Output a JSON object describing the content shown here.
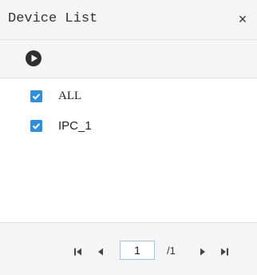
{
  "panel": {
    "title": "Device List",
    "close_symbol": "×"
  },
  "toolbar": {
    "play_icon": "play-circle-icon"
  },
  "devices": [
    {
      "label": "ALL",
      "checked": true
    },
    {
      "label": "IPC_1",
      "checked": true
    }
  ],
  "pagination": {
    "current_page": "1",
    "total_text": "/1"
  },
  "colors": {
    "accent": "#2d8fe0",
    "header_bg": "#f5f5f5",
    "border": "#dcdcdc"
  }
}
